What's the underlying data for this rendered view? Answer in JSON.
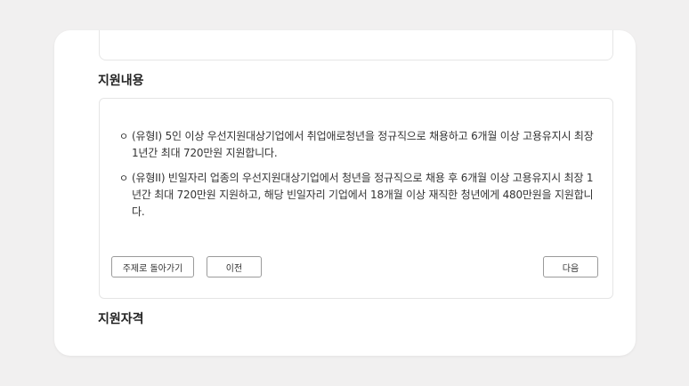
{
  "sections": {
    "support_content_title": "지원내용",
    "eligibility_title": "지원자격"
  },
  "content": {
    "bullet_symbol": "ㅇ",
    "items": [
      "(유형I) 5인 이상 우선지원대상기업에서 취업애로청년을 정규직으로 채용하고 6개월 이상 고용유지시 최장 1년간 최대 720만원 지원합니다.",
      "(유형II) 빈일자리 업종의 우선지원대상기업에서 청년을 정규직으로 채용 후 6개월 이상 고용유지시 최장 1년간 최대 720만원 지원하고, 해당 빈일자리 기업에서 18개월 이상 재직한 청년에게 480만원을 지원합니다."
    ]
  },
  "buttons": {
    "back_to_topic": "주제로 돌아가기",
    "previous": "이전",
    "next": "다음"
  }
}
